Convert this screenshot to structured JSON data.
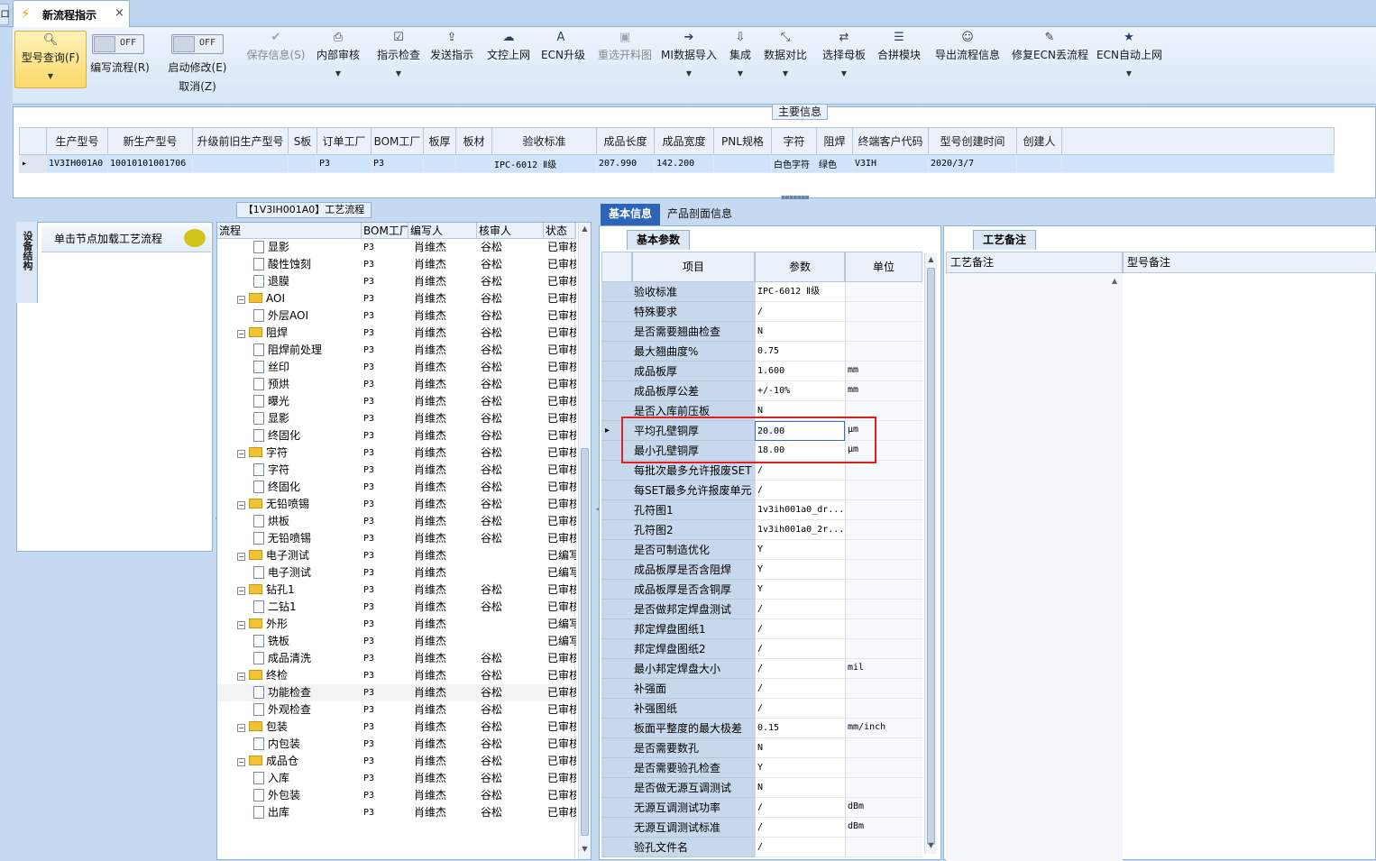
{
  "window": {
    "tab_title": "新流程指示",
    "close_glyph": "×",
    "left_stub": "ロ"
  },
  "ribbon": {
    "query": {
      "label": "型号查询(F)"
    },
    "write_flow": {
      "label": "编写流程(R)",
      "toggle": "OFF"
    },
    "start_modify": {
      "label": "启动修改(E)",
      "label2": "取消(Z)",
      "toggle": "OFF"
    },
    "buttons": [
      {
        "label": "保存信息(S)",
        "icon": "check-icon",
        "glyph": "✔",
        "disabled": true,
        "dropdown": false
      },
      {
        "label": "内部审核",
        "icon": "printer-icon",
        "glyph": "⎙",
        "disabled": false,
        "dropdown": true
      },
      {
        "label": "指示检查",
        "icon": "checkbox-icon",
        "glyph": "☑",
        "disabled": false,
        "dropdown": true
      },
      {
        "label": "发送指示",
        "icon": "upload-icon",
        "glyph": "⇪",
        "disabled": false,
        "dropdown": false
      },
      {
        "label": "文控上网",
        "icon": "cloud-upload-icon",
        "glyph": "☁",
        "disabled": false,
        "dropdown": false
      },
      {
        "label": "ECN升级",
        "icon": "font-icon",
        "glyph": "A",
        "disabled": false,
        "dropdown": false
      },
      {
        "label": "重选开料图",
        "icon": "image-icon",
        "glyph": "▣",
        "disabled": true,
        "dropdown": false
      },
      {
        "label": "MI数据导入",
        "icon": "sign-in-icon",
        "glyph": "➔",
        "disabled": false,
        "dropdown": true
      },
      {
        "label": "集成",
        "icon": "download-icon",
        "glyph": "⇩",
        "disabled": false,
        "dropdown": true
      },
      {
        "label": "数据对比",
        "icon": "compress-icon",
        "glyph": "⤡",
        "disabled": false,
        "dropdown": true
      },
      {
        "label": "选择母板",
        "icon": "shuffle-icon",
        "glyph": "⇄",
        "disabled": false,
        "dropdown": true
      },
      {
        "label": "合拼模块",
        "icon": "list-icon",
        "glyph": "☰",
        "disabled": false,
        "dropdown": false
      },
      {
        "label": "导出流程信息",
        "icon": "smile-icon",
        "glyph": "☺",
        "disabled": false,
        "dropdown": false
      },
      {
        "label": "修复ECN丢流程",
        "icon": "wrench-icon",
        "glyph": "✎",
        "disabled": false,
        "dropdown": false
      },
      {
        "label": "ECN自动上网",
        "icon": "star-icon",
        "glyph": "★",
        "disabled": false,
        "dropdown": true
      }
    ]
  },
  "main_info": {
    "title": "主要信息",
    "columns": [
      "生产型号",
      "新生产型号",
      "升级前旧生产型号",
      "S板",
      "订单工厂",
      "BOM工厂",
      "板厚",
      "板材",
      "验收标准",
      "成品长度",
      "成品宽度",
      "PNL规格",
      "字符",
      "阻焊",
      "终端客户代码",
      "型号创建时间",
      "创建人"
    ],
    "row": [
      "1V3IH001A0",
      "10010101001706",
      "",
      "",
      "P3",
      "P3",
      "",
      "",
      "IPC-6012 Ⅱ级",
      "207.990",
      "142.200",
      "",
      "白色字符",
      "绿色",
      "V3IH",
      "2020/3/7",
      ""
    ],
    "row_marker": "▸"
  },
  "side": {
    "tab": "设备结构",
    "header": "单击节点加载工艺流程"
  },
  "process": {
    "title": "【1V3IH001A0】工艺流程",
    "columns": [
      "流程",
      "BOM工厂",
      "编写人",
      "核审人",
      "状态"
    ],
    "rows": [
      {
        "name": "显影",
        "level": 2,
        "bom": "P3",
        "writer": "肖维杰",
        "reviewer": "谷松",
        "status": "已审核"
      },
      {
        "name": "酸性蚀刻",
        "level": 2,
        "bom": "P3",
        "writer": "肖维杰",
        "reviewer": "谷松",
        "status": "已审核"
      },
      {
        "name": "退膜",
        "level": 2,
        "bom": "P3",
        "writer": "肖维杰",
        "reviewer": "谷松",
        "status": "已审核"
      },
      {
        "name": "AOI",
        "level": 1,
        "bom": "P3",
        "writer": "肖维杰",
        "reviewer": "谷松",
        "status": "已审核"
      },
      {
        "name": "外层AOI",
        "level": 2,
        "bom": "P3",
        "writer": "肖维杰",
        "reviewer": "谷松",
        "status": "已审核"
      },
      {
        "name": "阻焊",
        "level": 1,
        "bom": "P3",
        "writer": "肖维杰",
        "reviewer": "谷松",
        "status": "已审核"
      },
      {
        "name": "阻焊前处理",
        "level": 2,
        "bom": "P3",
        "writer": "肖维杰",
        "reviewer": "谷松",
        "status": "已审核"
      },
      {
        "name": "丝印",
        "level": 2,
        "bom": "P3",
        "writer": "肖维杰",
        "reviewer": "谷松",
        "status": "已审核"
      },
      {
        "name": "预烘",
        "level": 2,
        "bom": "P3",
        "writer": "肖维杰",
        "reviewer": "谷松",
        "status": "已审核"
      },
      {
        "name": "曝光",
        "level": 2,
        "bom": "P3",
        "writer": "肖维杰",
        "reviewer": "谷松",
        "status": "已审核"
      },
      {
        "name": "显影",
        "level": 2,
        "bom": "P3",
        "writer": "肖维杰",
        "reviewer": "谷松",
        "status": "已审核"
      },
      {
        "name": "终固化",
        "level": 2,
        "bom": "P3",
        "writer": "肖维杰",
        "reviewer": "谷松",
        "status": "已审核"
      },
      {
        "name": "字符",
        "level": 1,
        "bom": "P3",
        "writer": "肖维杰",
        "reviewer": "谷松",
        "status": "已审核"
      },
      {
        "name": "字符",
        "level": 2,
        "bom": "P3",
        "writer": "肖维杰",
        "reviewer": "谷松",
        "status": "已审核"
      },
      {
        "name": "终固化",
        "level": 2,
        "bom": "P3",
        "writer": "肖维杰",
        "reviewer": "谷松",
        "status": "已审核"
      },
      {
        "name": "无铅喷锡",
        "level": 1,
        "bom": "P3",
        "writer": "肖维杰",
        "reviewer": "谷松",
        "status": "已审核"
      },
      {
        "name": "烘板",
        "level": 2,
        "bom": "P3",
        "writer": "肖维杰",
        "reviewer": "谷松",
        "status": "已审核"
      },
      {
        "name": "无铅喷锡",
        "level": 2,
        "bom": "P3",
        "writer": "肖维杰",
        "reviewer": "谷松",
        "status": "已审核"
      },
      {
        "name": "电子测试",
        "level": 1,
        "bom": "P3",
        "writer": "肖维杰",
        "reviewer": "",
        "status": "已编写"
      },
      {
        "name": "电子测试",
        "level": 2,
        "bom": "P3",
        "writer": "肖维杰",
        "reviewer": "",
        "status": "已编写"
      },
      {
        "name": "钻孔1",
        "level": 1,
        "bom": "P3",
        "writer": "肖维杰",
        "reviewer": "谷松",
        "status": "已审核"
      },
      {
        "name": "二钻1",
        "level": 2,
        "bom": "P3",
        "writer": "肖维杰",
        "reviewer": "谷松",
        "status": "已审核"
      },
      {
        "name": "外形",
        "level": 1,
        "bom": "P3",
        "writer": "肖维杰",
        "reviewer": "",
        "status": "已编写"
      },
      {
        "name": "铣板",
        "level": 2,
        "bom": "P3",
        "writer": "肖维杰",
        "reviewer": "",
        "status": "已编写"
      },
      {
        "name": "成品清洗",
        "level": 2,
        "bom": "P3",
        "writer": "肖维杰",
        "reviewer": "谷松",
        "status": "已审核"
      },
      {
        "name": "终检",
        "level": 1,
        "bom": "P3",
        "writer": "肖维杰",
        "reviewer": "谷松",
        "status": "已审核"
      },
      {
        "name": "功能检查",
        "level": 2,
        "bom": "P3",
        "writer": "肖维杰",
        "reviewer": "谷松",
        "status": "已审核",
        "highlight": true
      },
      {
        "name": "外观检查",
        "level": 2,
        "bom": "P3",
        "writer": "肖维杰",
        "reviewer": "谷松",
        "status": "已审核"
      },
      {
        "name": "包装",
        "level": 1,
        "bom": "P3",
        "writer": "肖维杰",
        "reviewer": "谷松",
        "status": "已审核"
      },
      {
        "name": "内包装",
        "level": 2,
        "bom": "P3",
        "writer": "肖维杰",
        "reviewer": "谷松",
        "status": "已审核"
      },
      {
        "name": "成品仓",
        "level": 1,
        "bom": "P3",
        "writer": "肖维杰",
        "reviewer": "谷松",
        "status": "已审核"
      },
      {
        "name": "入库",
        "level": 2,
        "bom": "P3",
        "writer": "肖维杰",
        "reviewer": "谷松",
        "status": "已审核"
      },
      {
        "name": "外包装",
        "level": 2,
        "bom": "P3",
        "writer": "肖维杰",
        "reviewer": "谷松",
        "status": "已审核"
      },
      {
        "name": "出库",
        "level": 2,
        "bom": "P3",
        "writer": "肖维杰",
        "reviewer": "谷松",
        "status": "已审核"
      }
    ]
  },
  "params": {
    "tabs": [
      "基本信息",
      "产品剖面信息"
    ],
    "subtab": "基本参数",
    "columns": [
      "项目",
      "参数",
      "单位"
    ],
    "rows": [
      {
        "item": "验收标准",
        "value": "IPC-6012 Ⅱ级",
        "unit": ""
      },
      {
        "item": "特殊要求",
        "value": "/",
        "unit": ""
      },
      {
        "item": "是否需要翘曲检查",
        "value": "N",
        "unit": ""
      },
      {
        "item": "最大翘曲度%",
        "value": "0.75",
        "unit": ""
      },
      {
        "item": "成品板厚",
        "value": "1.600",
        "unit": "mm"
      },
      {
        "item": "成品板厚公差",
        "value": "+/-10%",
        "unit": "mm"
      },
      {
        "item": "是否入库前压板",
        "value": "N",
        "unit": ""
      },
      {
        "item": "平均孔壁铜厚",
        "value": "20.00",
        "unit": "μm",
        "focus": true
      },
      {
        "item": "最小孔壁铜厚",
        "value": "18.00",
        "unit": "μm"
      },
      {
        "item": "每批次最多允许报废SET",
        "value": "/",
        "unit": ""
      },
      {
        "item": "每SET最多允许报废单元",
        "value": "/",
        "unit": ""
      },
      {
        "item": "孔符图1",
        "value": "1v3ih001a0_dr...",
        "unit": ""
      },
      {
        "item": "孔符图2",
        "value": "1v3ih001a0_2r...",
        "unit": ""
      },
      {
        "item": "是否可制造优化",
        "value": "Y",
        "unit": ""
      },
      {
        "item": "成品板厚是否含阻焊",
        "value": "Y",
        "unit": ""
      },
      {
        "item": "成品板厚是否含铜厚",
        "value": "Y",
        "unit": ""
      },
      {
        "item": "是否做邦定焊盘测试",
        "value": "/",
        "unit": ""
      },
      {
        "item": "邦定焊盘图纸1",
        "value": "/",
        "unit": ""
      },
      {
        "item": "邦定焊盘图纸2",
        "value": "/",
        "unit": ""
      },
      {
        "item": "最小邦定焊盘大小",
        "value": "/",
        "unit": "mil"
      },
      {
        "item": "补强面",
        "value": "/",
        "unit": ""
      },
      {
        "item": "补强图纸",
        "value": "/",
        "unit": ""
      },
      {
        "item": "板面平整度的最大极差",
        "value": "0.15",
        "unit": "mm/inch"
      },
      {
        "item": "是否需要数孔",
        "value": "N",
        "unit": ""
      },
      {
        "item": "是否需要验孔检查",
        "value": "Y",
        "unit": ""
      },
      {
        "item": "是否做无源互调测试",
        "value": "N",
        "unit": ""
      },
      {
        "item": "无源互调测试功率",
        "value": "/",
        "unit": "dBm"
      },
      {
        "item": "无源互调测试标准",
        "value": "/",
        "unit": "dBm"
      },
      {
        "item": "验孔文件名",
        "value": "/",
        "unit": ""
      }
    ]
  },
  "notes": {
    "tab": "工艺备注",
    "columns": [
      "工艺备注",
      "型号备注"
    ]
  }
}
